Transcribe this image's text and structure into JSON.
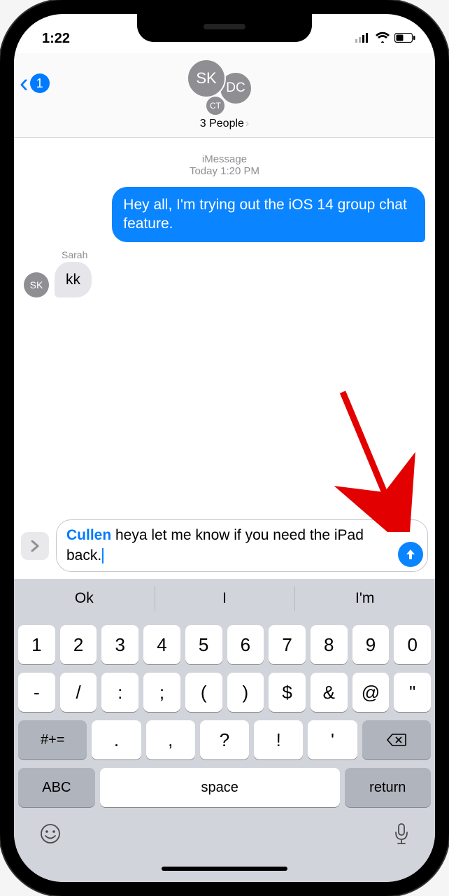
{
  "status": {
    "time": "1:22"
  },
  "nav": {
    "back_badge": "1",
    "avatars": {
      "sk": "SK",
      "dc": "DC",
      "ct": "CT"
    },
    "title": "3 People"
  },
  "timestamp": {
    "service": "iMessage",
    "line": "Today 1:20 PM"
  },
  "messages": {
    "out1": "Hey all, I'm trying out the iOS 14 group chat feature.",
    "in1_sender": "Sarah",
    "in1_avatar": "SK",
    "in1_text": "kk"
  },
  "compose": {
    "mention": "Cullen",
    "rest": " heya let me know if you need the iPad back."
  },
  "predictive": {
    "p1": "Ok",
    "p2": "I",
    "p3": "I'm"
  },
  "keyboard": {
    "row1": [
      "1",
      "2",
      "3",
      "4",
      "5",
      "6",
      "7",
      "8",
      "9",
      "0"
    ],
    "row2": [
      "-",
      "/",
      ":",
      ";",
      "(",
      ")",
      "$",
      "&",
      "@",
      "\""
    ],
    "shift": "#+=",
    "row3": [
      ".",
      ",",
      "?",
      "!",
      "'"
    ],
    "abc": "ABC",
    "space": "space",
    "return": "return"
  }
}
